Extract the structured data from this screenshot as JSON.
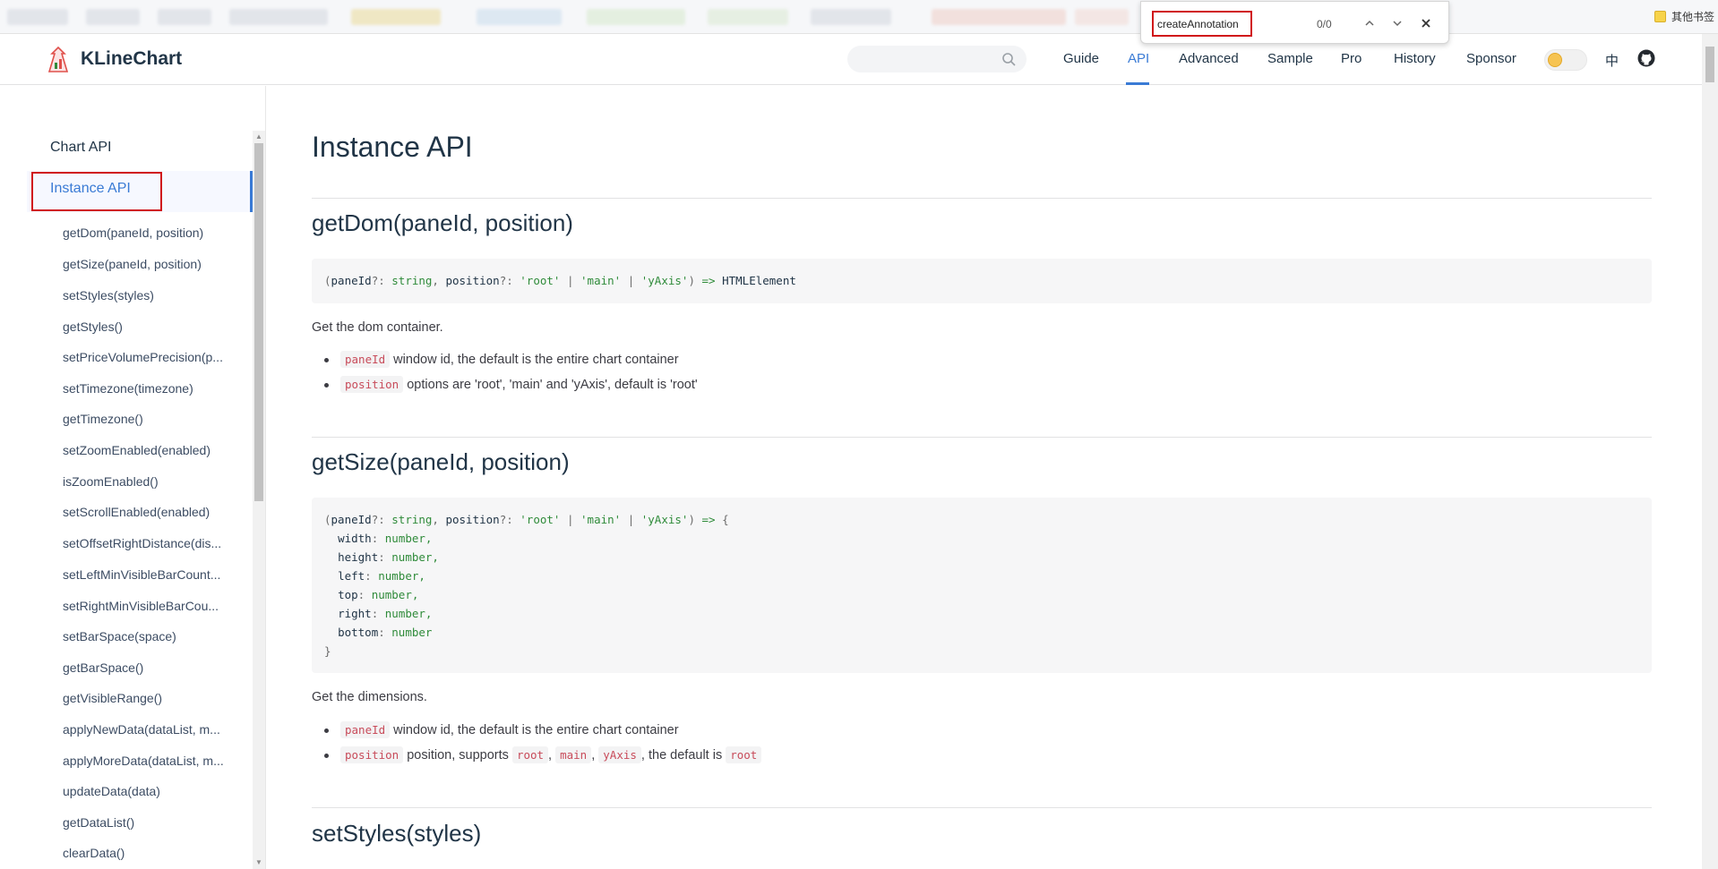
{
  "browser": {
    "other_bookmarks": "其他书签"
  },
  "find_bar": {
    "query": "createAnnotation",
    "count": "0/0"
  },
  "header": {
    "site_title": "KLineChart",
    "search_placeholder": "",
    "nav": [
      {
        "label": "Guide"
      },
      {
        "label": "API"
      },
      {
        "label": "Advanced"
      },
      {
        "label": "Sample"
      },
      {
        "label": "Pro"
      },
      {
        "label": "History"
      },
      {
        "label": "Sponsor"
      }
    ],
    "active_nav": "API",
    "lang": "中",
    "accent_color": "#3a7bd5"
  },
  "sidebar": {
    "sections": [
      {
        "label": "Chart API"
      },
      {
        "label": "Instance API"
      }
    ],
    "active_section": "Instance API",
    "items": [
      {
        "label": "getDom(paneId, position)"
      },
      {
        "label": "getSize(paneId, position)"
      },
      {
        "label": "setStyles(styles)"
      },
      {
        "label": "getStyles()"
      },
      {
        "label": "setPriceVolumePrecision(p..."
      },
      {
        "label": "setTimezone(timezone)"
      },
      {
        "label": "getTimezone()"
      },
      {
        "label": "setZoomEnabled(enabled)"
      },
      {
        "label": "isZoomEnabled()"
      },
      {
        "label": "setScrollEnabled(enabled)"
      },
      {
        "label": "setOffsetRightDistance(dis..."
      },
      {
        "label": "setLeftMinVisibleBarCount..."
      },
      {
        "label": "setRightMinVisibleBarCou..."
      },
      {
        "label": "setBarSpace(space)"
      },
      {
        "label": "getBarSpace()"
      },
      {
        "label": "getVisibleRange()"
      },
      {
        "label": "applyNewData(dataList, m..."
      },
      {
        "label": "applyMoreData(dataList, m..."
      },
      {
        "label": "updateData(data)"
      },
      {
        "label": "getDataList()"
      },
      {
        "label": "clearData()"
      }
    ]
  },
  "main": {
    "page_title": "Instance API",
    "sections": [
      {
        "heading": "getDom(paneId, position)",
        "signature": {
          "p1": "paneId",
          "p1_type": "string",
          "p2": "position",
          "opts": [
            "'root'",
            "'main'",
            "'yAxis'"
          ],
          "ret": "HTMLElement"
        },
        "description": "Get the dom container.",
        "bullets": [
          {
            "code": "paneId",
            "text": " window id, the default is the entire chart container"
          },
          {
            "code": "position",
            "text": " options are 'root', 'main' and 'yAxis', default is 'root'"
          }
        ]
      },
      {
        "heading": "getSize(paneId, position)",
        "signature": {
          "p1": "paneId",
          "p1_type": "string",
          "p2": "position",
          "opts": [
            "'root'",
            "'main'",
            "'yAxis'"
          ],
          "fields": [
            {
              "name": "width",
              "type": "number,"
            },
            {
              "name": "height",
              "type": "number,"
            },
            {
              "name": "left",
              "type": "number,"
            },
            {
              "name": "top",
              "type": "number,"
            },
            {
              "name": "right",
              "type": "number,"
            },
            {
              "name": "bottom",
              "type": "number"
            }
          ]
        },
        "description": "Get the dimensions.",
        "bullets": [
          {
            "code": "paneId",
            "text": " window id, the default is the entire chart container"
          }
        ],
        "position_bullet": {
          "code": "position",
          "text1": " position, supports ",
          "c1": "root",
          "c2": "main",
          "c3": "yAxis",
          "text2": ", the default is ",
          "c4": "root"
        }
      },
      {
        "heading": "setStyles(styles)"
      }
    ]
  }
}
